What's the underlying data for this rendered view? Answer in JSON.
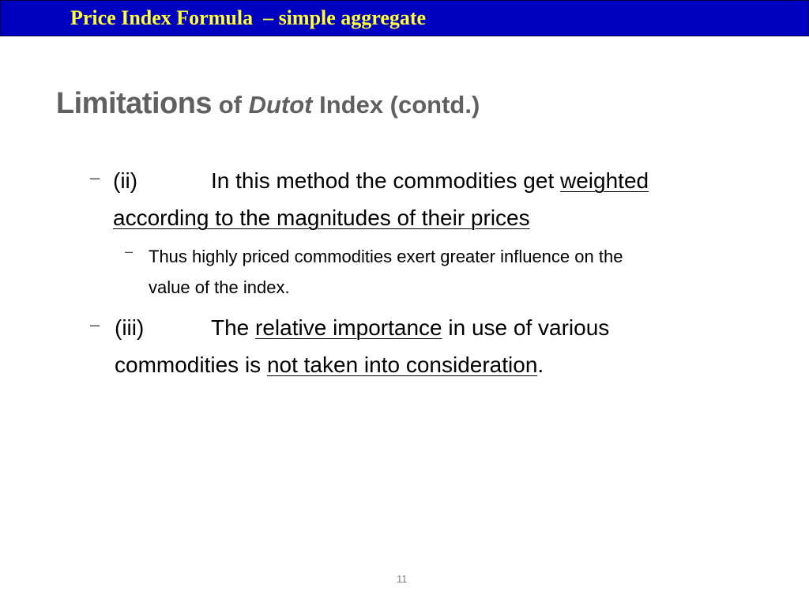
{
  "header": {
    "title": "Price Index Formula  – simple aggregate",
    "bg_color": "#0000c0",
    "text_color": "#ffff33"
  },
  "slide": {
    "title_part1": "Limitations",
    "title_part2": " of ",
    "title_part3": "Dutot",
    "title_part4": " Index (contd.)",
    "bullets": [
      {
        "marker": "–",
        "label": "(ii)",
        "text_plain": "In this method the commodities get ",
        "text_underlined_1": "weighted",
        "text_underlined_2": "according to the magnitudes of their prices",
        "sub_marker": "–",
        "sub_line1": "Thus highly priced commodities exert greater influence on the",
        "sub_line2": "value of the index."
      },
      {
        "marker": "–",
        "label": "(iii)",
        "text_plain_1": "The ",
        "text_underlined_1": "relative importance",
        "text_plain_2": " in use of various",
        "text_plain_3": "commodities is ",
        "text_underlined_2": "not taken into consideration",
        "text_plain_4": "."
      }
    ]
  },
  "footer": {
    "page_number": "11"
  }
}
